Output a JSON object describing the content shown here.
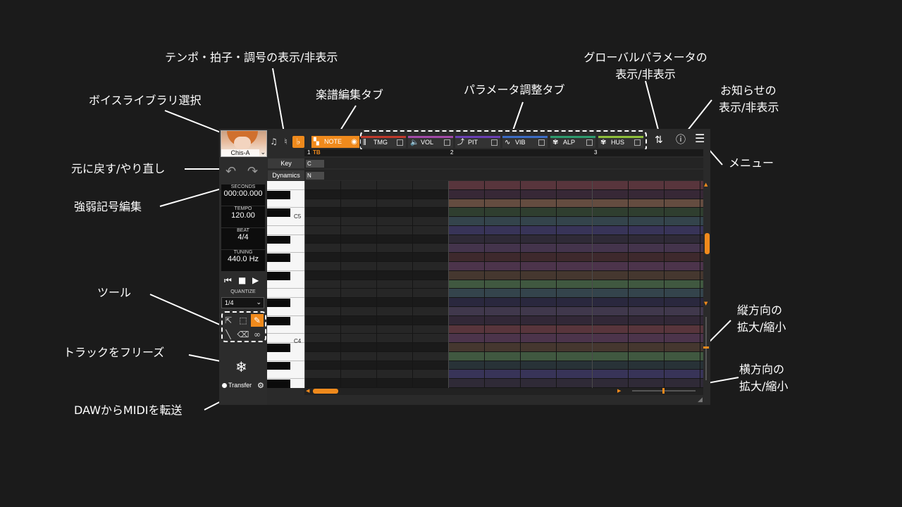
{
  "callouts": {
    "tempo_visibility": "テンポ・拍子・調号の表示/非表示",
    "global_param_line1": "グローバルパラメータの",
    "global_param_line2": "表示/非表示",
    "voice_library": "ボイスライブラリ選択",
    "score_edit_tab": "楽譜編集タブ",
    "param_tab": "パラメータ調整タブ",
    "news_line1": "お知らせの",
    "news_line2": "表示/非表示",
    "undo_redo": "元に戻す/やり直し",
    "menu": "メニュー",
    "dynamics_edit": "強弱記号編集",
    "tools": "ツール",
    "vertical_zoom_line1": "縦方向の",
    "vertical_zoom_line2": "拡大/縮小",
    "freeze_track": "トラックをフリーズ",
    "horizontal_zoom_line1": "横方向の",
    "horizontal_zoom_line2": "拡大/縮小",
    "daw_midi": "DAWからMIDIを転送"
  },
  "editor": {
    "voice_name": "Chis-A",
    "seconds_label": "SECONDS",
    "seconds_value": "000:00.000",
    "tempo_label": "TEMPO",
    "tempo_value": "120.00",
    "beat_label": "BEAT",
    "beat_value": "4/4",
    "tuning_label": "TUNING",
    "tuning_value": "440.0 Hz",
    "quantize_label": "QUANTIZE",
    "quantize_value": "1/4",
    "transfer_label": "Transfer",
    "note_tab": "NOTE",
    "param_tabs": [
      {
        "label": "TMG",
        "color": "#c0392b",
        "icon": "timing-icon"
      },
      {
        "label": "VOL",
        "color": "#a24aa8",
        "icon": "volume-icon"
      },
      {
        "label": "PIT",
        "color": "#6a3fb5",
        "icon": "pitch-icon"
      },
      {
        "label": "VIB",
        "color": "#3c6cc4",
        "icon": "vibrato-icon"
      },
      {
        "label": "ALP",
        "color": "#2e9b6e",
        "icon": "alpha-icon"
      },
      {
        "label": "HUS",
        "color": "#8fbf3a",
        "icon": "husky-icon"
      }
    ],
    "key_label": "Key",
    "key_value": "C",
    "dynamics_label": "Dynamics",
    "dynamics_value": "N",
    "measures": [
      "1",
      "2",
      "3"
    ],
    "tb_label": "TB",
    "c5_label": "C5",
    "c4_label": "C4",
    "accent_color": "#f08a1c"
  }
}
